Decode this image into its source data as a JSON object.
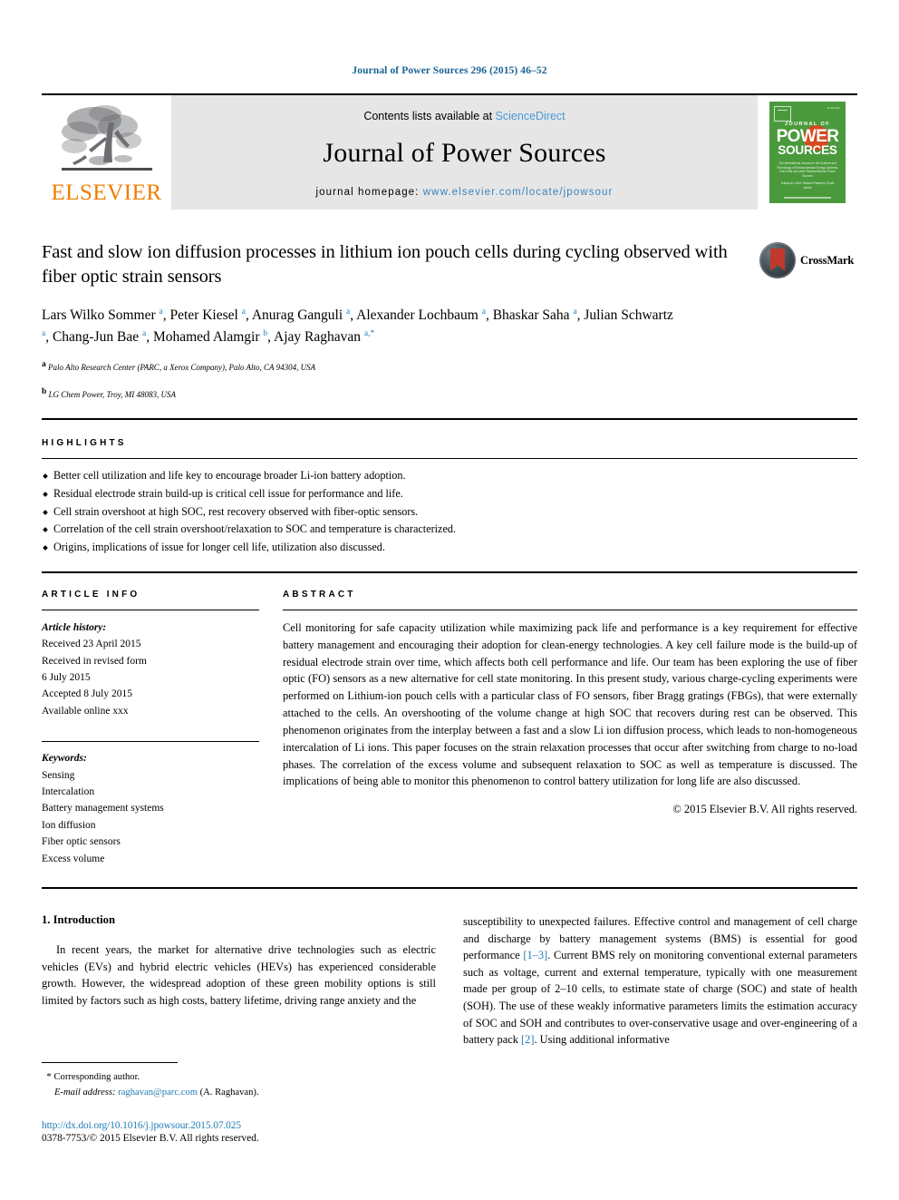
{
  "running_head": "Journal of Power Sources 296 (2015) 46–52",
  "masthead": {
    "publisher_name": "ELSEVIER",
    "contents_prefix": "Contents lists available at",
    "contents_link": "ScienceDirect",
    "journal_name": "Journal of Power Sources",
    "homepage_prefix": "journal homepage:",
    "homepage_url": "www.elsevier.com/locate/jpowsour",
    "cover": {
      "top_small": "ELSEVIER",
      "line1": "JOURNAL OF",
      "line2": "POWER",
      "line3": "SOURCES",
      "description": "The International Journal on the Science and Technology of Electrochemical Energy Systems, Fuel Cells and other Electrochemical Power Sources",
      "editors": "Editors-in-Chief: Stefano Passerini, Khalil Amine"
    },
    "accent_link_color": "#4a9ad4",
    "elsevier_orange": "#ef7d00",
    "cover_green": "#4a9a3c"
  },
  "article": {
    "title": "Fast and slow ion diffusion processes in lithium ion pouch cells during cycling observed with fiber optic strain sensors",
    "authors_html": "Lars Wilko Sommer <sup>a</sup>, Peter Kiesel <sup>a</sup>, Anurag Ganguli <sup>a</sup>, Alexander Lochbaum <sup>a</sup>, Bhaskar Saha <sup>a</sup>, Julian Schwartz <sup>a</sup>, Chang-Jun Bae <sup>a</sup>, Mohamed Alamgir <sup>b</sup>, Ajay Raghavan <sup>a,</sup><sup>*</sup>",
    "affiliation_a": "Palo Alto Research Center (PARC, a Xerox Company), Palo Alto, CA 94304, USA",
    "affiliation_b": "LG Chem Power, Troy, MI 48083, USA",
    "crossmark_label": "CrossMark"
  },
  "highlights": {
    "heading": "Highlights",
    "items": [
      "Better cell utilization and life key to encourage broader Li-ion battery adoption.",
      "Residual electrode strain build-up is critical cell issue for performance and life.",
      "Cell strain overshoot at high SOC, rest recovery observed with fiber-optic sensors.",
      "Correlation of the cell strain overshoot/relaxation to SOC and temperature is characterized.",
      "Origins, implications of issue for longer cell life, utilization also discussed."
    ]
  },
  "article_info": {
    "heading": "Article info",
    "history_title": "Article history:",
    "history_lines": [
      "Received 23 April 2015",
      "Received in revised form",
      "6 July 2015",
      "Accepted 8 July 2015",
      "Available online xxx"
    ],
    "keywords_title": "Keywords:",
    "keywords": [
      "Sensing",
      "Intercalation",
      "Battery management systems",
      "Ion diffusion",
      "Fiber optic sensors",
      "Excess volume"
    ]
  },
  "abstract": {
    "heading": "Abstract",
    "text": "Cell monitoring for safe capacity utilization while maximizing pack life and performance is a key requirement for effective battery management and encouraging their adoption for clean-energy technologies. A key cell failure mode is the build-up of residual electrode strain over time, which affects both cell performance and life. Our team has been exploring the use of fiber optic (FO) sensors as a new alternative for cell state monitoring. In this present study, various charge-cycling experiments were performed on Lithium-ion pouch cells with a particular class of FO sensors, fiber Bragg gratings (FBGs), that were externally attached to the cells. An overshooting of the volume change at high SOC that recovers during rest can be observed. This phenomenon originates from the interplay between a fast and a slow Li ion diffusion process, which leads to non-homogeneous intercalation of Li ions. This paper focuses on the strain relaxation processes that occur after switching from charge to no-load phases. The correlation of the excess volume and subsequent relaxation to SOC as well as temperature is discussed. The implications of being able to monitor this phenomenon to control battery utilization for long life are also discussed.",
    "copyright": "© 2015 Elsevier B.V. All rights reserved."
  },
  "body": {
    "section_number_title": "1. Introduction",
    "left_paragraph": "In recent years, the market for alternative drive technologies such as electric vehicles (EVs) and hybrid electric vehicles (HEVs) has experienced considerable growth. However, the widespread adoption of these green mobility options is still limited by factors such as high costs, battery lifetime, driving range anxiety and the",
    "right_paragraph_part1": "susceptibility to unexpected failures. Effective control and management of cell charge and discharge by battery management systems (BMS) is essential for good performance ",
    "right_ref_1": "[1–3]",
    "right_paragraph_part2": ". Current BMS rely on monitoring conventional external parameters such as voltage, current and external temperature, typically with one measurement made per group of 2–10 cells, to estimate state of charge (SOC) and state of health (SOH). The use of these weakly informative parameters limits the estimation accuracy of SOC and SOH and contributes to over-conservative usage and over-engineering of a battery pack ",
    "right_ref_2": "[2]",
    "right_paragraph_part3": ". Using additional informative"
  },
  "footer": {
    "corresponding_marker": "*",
    "corresponding_text": "Corresponding author.",
    "email_label": "E-mail address:",
    "email": "raghavan@parc.com",
    "email_suffix": "(A. Raghavan).",
    "doi": "http://dx.doi.org/10.1016/j.jpowsour.2015.07.025",
    "issn_line": "0378-7753/© 2015 Elsevier B.V. All rights reserved."
  }
}
